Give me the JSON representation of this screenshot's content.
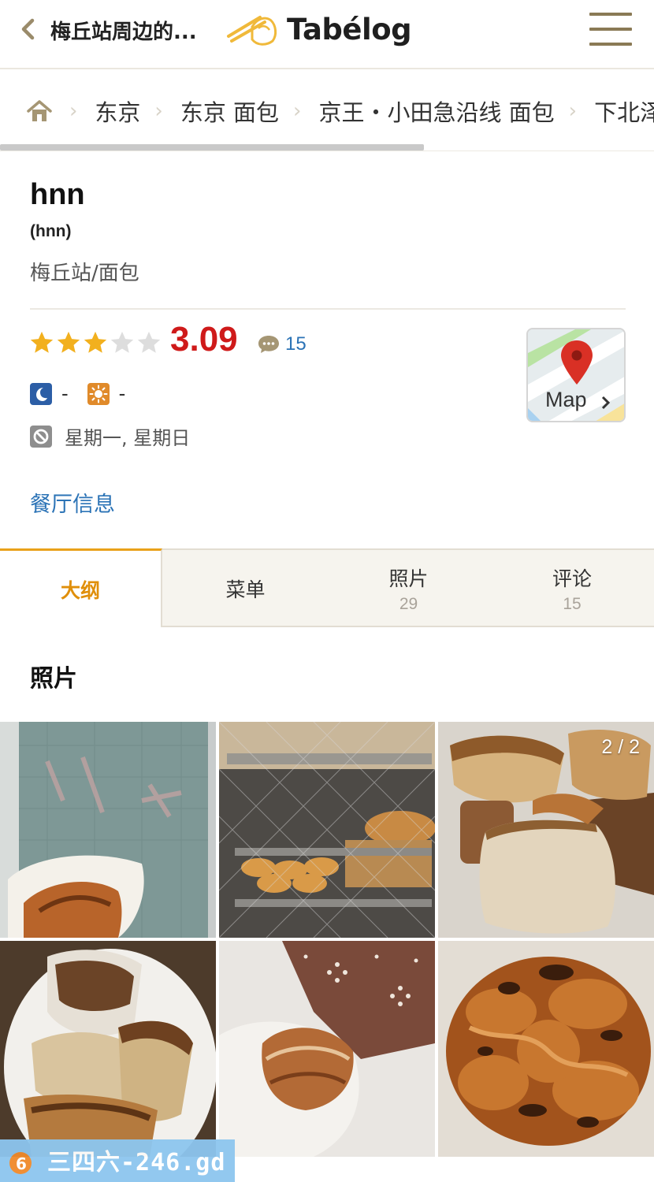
{
  "header": {
    "back_title": "梅丘站周边的...",
    "logo_text": "Tabélog"
  },
  "breadcrumb": {
    "items": [
      "东京",
      "东京 面包",
      "京王・小田急沿线 面包",
      "下北泽"
    ]
  },
  "restaurant": {
    "name": "hnn",
    "name_sub": "(hnn)",
    "category": "梅丘站/面包",
    "rating": "3.09",
    "rating_value": 3.09,
    "stars_filled": 3,
    "stars_total": 5,
    "review_count": "15",
    "dinner_budget": "-",
    "lunch_budget": "-",
    "closed_days": "星期一, 星期日",
    "map_label": "Map"
  },
  "info_link": "餐厅信息",
  "tabs": [
    {
      "label": "大纲",
      "count": ""
    },
    {
      "label": "菜单",
      "count": ""
    },
    {
      "label": "照片",
      "count": "29"
    },
    {
      "label": "评论",
      "count": "15"
    }
  ],
  "photos": {
    "title": "照片",
    "counter": "2 / 2"
  },
  "watermark": {
    "text": "三四六-246.gd"
  },
  "colors": {
    "accent_orange": "#e9a11a",
    "score_red": "#cf1a1a",
    "link_blue": "#2b73b6",
    "star_gold": "#f2b01e"
  },
  "icons": [
    "chevron-left-icon",
    "hamburger-menu-icon",
    "home-icon",
    "chat-bubble-icon",
    "moon-icon",
    "sun-icon",
    "no-entry-icon",
    "map-pin-icon"
  ]
}
